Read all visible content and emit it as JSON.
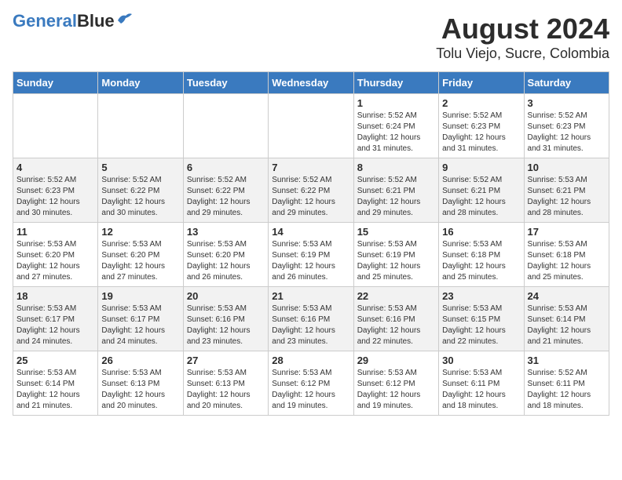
{
  "header": {
    "logo_line1": "General",
    "logo_line2": "Blue",
    "title": "August 2024",
    "subtitle": "Tolu Viejo, Sucre, Colombia"
  },
  "weekdays": [
    "Sunday",
    "Monday",
    "Tuesday",
    "Wednesday",
    "Thursday",
    "Friday",
    "Saturday"
  ],
  "weeks": [
    [
      {
        "day": "",
        "info": ""
      },
      {
        "day": "",
        "info": ""
      },
      {
        "day": "",
        "info": ""
      },
      {
        "day": "",
        "info": ""
      },
      {
        "day": "1",
        "info": "Sunrise: 5:52 AM\nSunset: 6:24 PM\nDaylight: 12 hours\nand 31 minutes."
      },
      {
        "day": "2",
        "info": "Sunrise: 5:52 AM\nSunset: 6:23 PM\nDaylight: 12 hours\nand 31 minutes."
      },
      {
        "day": "3",
        "info": "Sunrise: 5:52 AM\nSunset: 6:23 PM\nDaylight: 12 hours\nand 31 minutes."
      }
    ],
    [
      {
        "day": "4",
        "info": "Sunrise: 5:52 AM\nSunset: 6:23 PM\nDaylight: 12 hours\nand 30 minutes."
      },
      {
        "day": "5",
        "info": "Sunrise: 5:52 AM\nSunset: 6:22 PM\nDaylight: 12 hours\nand 30 minutes."
      },
      {
        "day": "6",
        "info": "Sunrise: 5:52 AM\nSunset: 6:22 PM\nDaylight: 12 hours\nand 29 minutes."
      },
      {
        "day": "7",
        "info": "Sunrise: 5:52 AM\nSunset: 6:22 PM\nDaylight: 12 hours\nand 29 minutes."
      },
      {
        "day": "8",
        "info": "Sunrise: 5:52 AM\nSunset: 6:21 PM\nDaylight: 12 hours\nand 29 minutes."
      },
      {
        "day": "9",
        "info": "Sunrise: 5:52 AM\nSunset: 6:21 PM\nDaylight: 12 hours\nand 28 minutes."
      },
      {
        "day": "10",
        "info": "Sunrise: 5:53 AM\nSunset: 6:21 PM\nDaylight: 12 hours\nand 28 minutes."
      }
    ],
    [
      {
        "day": "11",
        "info": "Sunrise: 5:53 AM\nSunset: 6:20 PM\nDaylight: 12 hours\nand 27 minutes."
      },
      {
        "day": "12",
        "info": "Sunrise: 5:53 AM\nSunset: 6:20 PM\nDaylight: 12 hours\nand 27 minutes."
      },
      {
        "day": "13",
        "info": "Sunrise: 5:53 AM\nSunset: 6:20 PM\nDaylight: 12 hours\nand 26 minutes."
      },
      {
        "day": "14",
        "info": "Sunrise: 5:53 AM\nSunset: 6:19 PM\nDaylight: 12 hours\nand 26 minutes."
      },
      {
        "day": "15",
        "info": "Sunrise: 5:53 AM\nSunset: 6:19 PM\nDaylight: 12 hours\nand 25 minutes."
      },
      {
        "day": "16",
        "info": "Sunrise: 5:53 AM\nSunset: 6:18 PM\nDaylight: 12 hours\nand 25 minutes."
      },
      {
        "day": "17",
        "info": "Sunrise: 5:53 AM\nSunset: 6:18 PM\nDaylight: 12 hours\nand 25 minutes."
      }
    ],
    [
      {
        "day": "18",
        "info": "Sunrise: 5:53 AM\nSunset: 6:17 PM\nDaylight: 12 hours\nand 24 minutes."
      },
      {
        "day": "19",
        "info": "Sunrise: 5:53 AM\nSunset: 6:17 PM\nDaylight: 12 hours\nand 24 minutes."
      },
      {
        "day": "20",
        "info": "Sunrise: 5:53 AM\nSunset: 6:16 PM\nDaylight: 12 hours\nand 23 minutes."
      },
      {
        "day": "21",
        "info": "Sunrise: 5:53 AM\nSunset: 6:16 PM\nDaylight: 12 hours\nand 23 minutes."
      },
      {
        "day": "22",
        "info": "Sunrise: 5:53 AM\nSunset: 6:16 PM\nDaylight: 12 hours\nand 22 minutes."
      },
      {
        "day": "23",
        "info": "Sunrise: 5:53 AM\nSunset: 6:15 PM\nDaylight: 12 hours\nand 22 minutes."
      },
      {
        "day": "24",
        "info": "Sunrise: 5:53 AM\nSunset: 6:14 PM\nDaylight: 12 hours\nand 21 minutes."
      }
    ],
    [
      {
        "day": "25",
        "info": "Sunrise: 5:53 AM\nSunset: 6:14 PM\nDaylight: 12 hours\nand 21 minutes."
      },
      {
        "day": "26",
        "info": "Sunrise: 5:53 AM\nSunset: 6:13 PM\nDaylight: 12 hours\nand 20 minutes."
      },
      {
        "day": "27",
        "info": "Sunrise: 5:53 AM\nSunset: 6:13 PM\nDaylight: 12 hours\nand 20 minutes."
      },
      {
        "day": "28",
        "info": "Sunrise: 5:53 AM\nSunset: 6:12 PM\nDaylight: 12 hours\nand 19 minutes."
      },
      {
        "day": "29",
        "info": "Sunrise: 5:53 AM\nSunset: 6:12 PM\nDaylight: 12 hours\nand 19 minutes."
      },
      {
        "day": "30",
        "info": "Sunrise: 5:53 AM\nSunset: 6:11 PM\nDaylight: 12 hours\nand 18 minutes."
      },
      {
        "day": "31",
        "info": "Sunrise: 5:52 AM\nSunset: 6:11 PM\nDaylight: 12 hours\nand 18 minutes."
      }
    ]
  ]
}
